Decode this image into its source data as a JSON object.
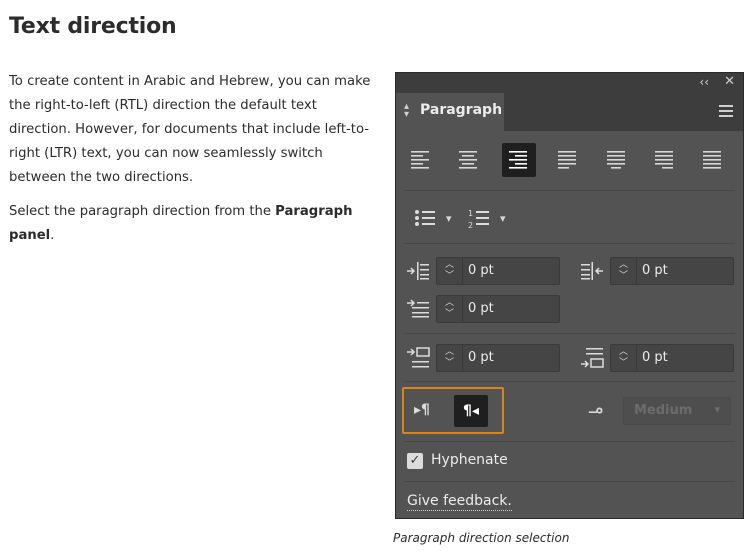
{
  "article": {
    "heading": "Text direction",
    "paragraph1": "To create content in Arabic and Hebrew, you can make the right-to-left (RTL) direction the default text direction. However, for documents that include left-to-right (LTR) text, you can now seamlessly switch between the two directions.",
    "paragraph2_prefix": "Select the paragraph direction from the ",
    "paragraph2_bold": "Paragraph panel",
    "paragraph2_suffix": ".",
    "caption": "Paragraph direction selection"
  },
  "panel": {
    "titlebar": {
      "collapse_glyph": "‹‹",
      "close_glyph": "✕"
    },
    "tab": {
      "label": "Paragraph"
    },
    "alignment_buttons": [
      {
        "name": "align-left",
        "active": false
      },
      {
        "name": "align-center",
        "active": false
      },
      {
        "name": "align-right",
        "active": true
      },
      {
        "name": "justify-last-left",
        "active": false
      },
      {
        "name": "justify-last-center",
        "active": false
      },
      {
        "name": "justify-last-right",
        "active": false
      },
      {
        "name": "justify-all",
        "active": false
      }
    ],
    "fields": {
      "left_indent": "0 pt",
      "right_indent": "0 pt",
      "first_line_indent": "0 pt",
      "space_before": "0 pt",
      "space_after": "0 pt"
    },
    "direction": {
      "ltr_glyph": "▸¶",
      "rtl_glyph": "¶◂",
      "selected": "rtl"
    },
    "kashida": {
      "icon_glyph": "مـ",
      "value": "Medium",
      "disabled": true
    },
    "hyphenate": {
      "label": "Hyphenate",
      "checked": true
    },
    "feedback_link": "Give feedback."
  }
}
